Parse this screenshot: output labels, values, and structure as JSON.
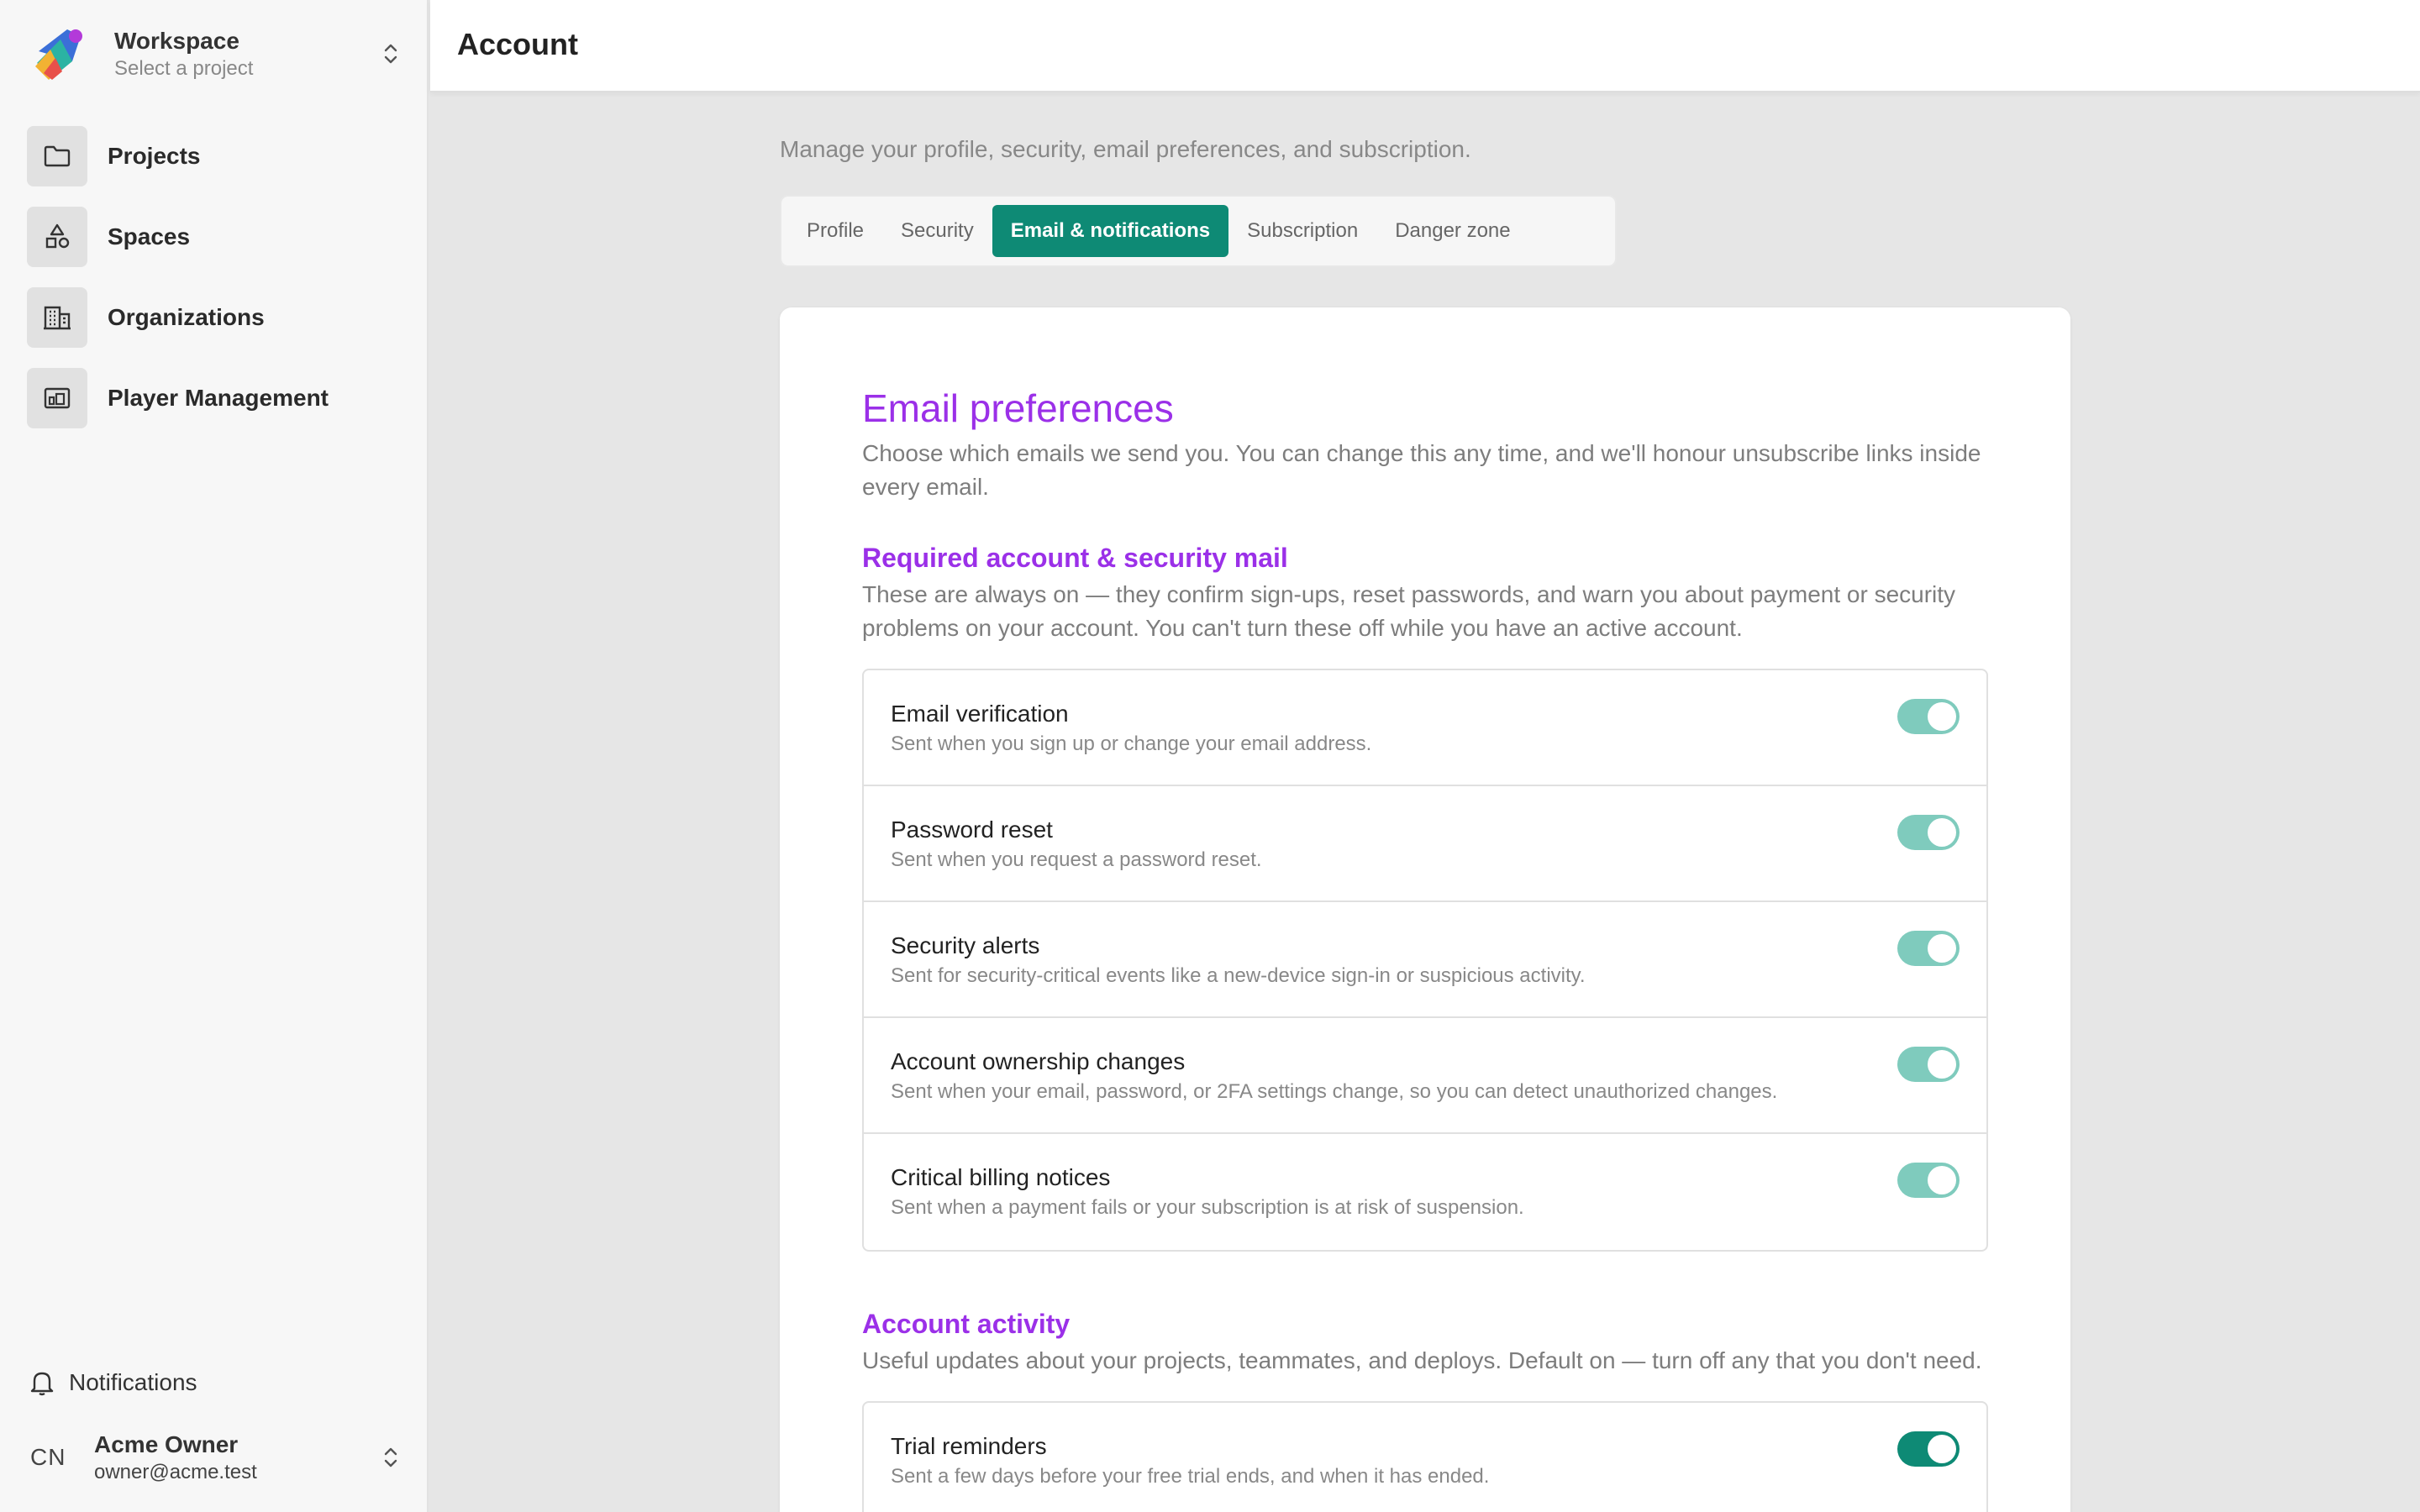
{
  "workspace": {
    "title": "Workspace",
    "subtitle": "Select a project"
  },
  "nav": {
    "items": [
      {
        "label": "Projects",
        "icon": "folder-icon"
      },
      {
        "label": "Spaces",
        "icon": "shapes-icon"
      },
      {
        "label": "Organizations",
        "icon": "building-icon"
      },
      {
        "label": "Player Management",
        "icon": "player-icon"
      }
    ]
  },
  "notifications": {
    "label": "Notifications"
  },
  "user": {
    "initials": "CN",
    "name": "Acme Owner",
    "email": "owner@acme.test"
  },
  "header": {
    "title": "Account"
  },
  "main": {
    "subtitle": "Manage your profile, security, email preferences, and subscription.",
    "tabs": [
      {
        "label": "Profile",
        "active": false
      },
      {
        "label": "Security",
        "active": false
      },
      {
        "label": "Email & notifications",
        "active": true
      },
      {
        "label": "Subscription",
        "active": false
      },
      {
        "label": "Danger zone",
        "active": false
      }
    ]
  },
  "email_prefs": {
    "title": "Email preferences",
    "description": "Choose which emails we send you. You can change this any time, and we'll honour unsubscribe links inside every email.",
    "required": {
      "title": "Required account & security mail",
      "description": "These are always on — they confirm sign-ups, reset passwords, and warn you about payment or security problems on your account. You can't turn these off while you have an active account.",
      "items": [
        {
          "title": "Email verification",
          "desc": "Sent when you sign up or change your email address.",
          "on": true
        },
        {
          "title": "Password reset",
          "desc": "Sent when you request a password reset.",
          "on": true
        },
        {
          "title": "Security alerts",
          "desc": "Sent for security-critical events like a new-device sign-in or suspicious activity.",
          "on": true
        },
        {
          "title": "Account ownership changes",
          "desc": "Sent when your email, password, or 2FA settings change, so you can detect unauthorized changes.",
          "on": true
        },
        {
          "title": "Critical billing notices",
          "desc": "Sent when a payment fails or your subscription is at risk of suspension.",
          "on": true
        }
      ]
    },
    "activity": {
      "title": "Account activity",
      "description": "Useful updates about your projects, teammates, and deploys. Default on — turn off any that you don't need.",
      "items": [
        {
          "title": "Trial reminders",
          "desc": "Sent a few days before your free trial ends, and when it has ended.",
          "on": true
        }
      ]
    }
  },
  "colors": {
    "accent": "#0e8a75",
    "heading": "#9b30e8",
    "toggle_locked": "#7fcbbd"
  }
}
